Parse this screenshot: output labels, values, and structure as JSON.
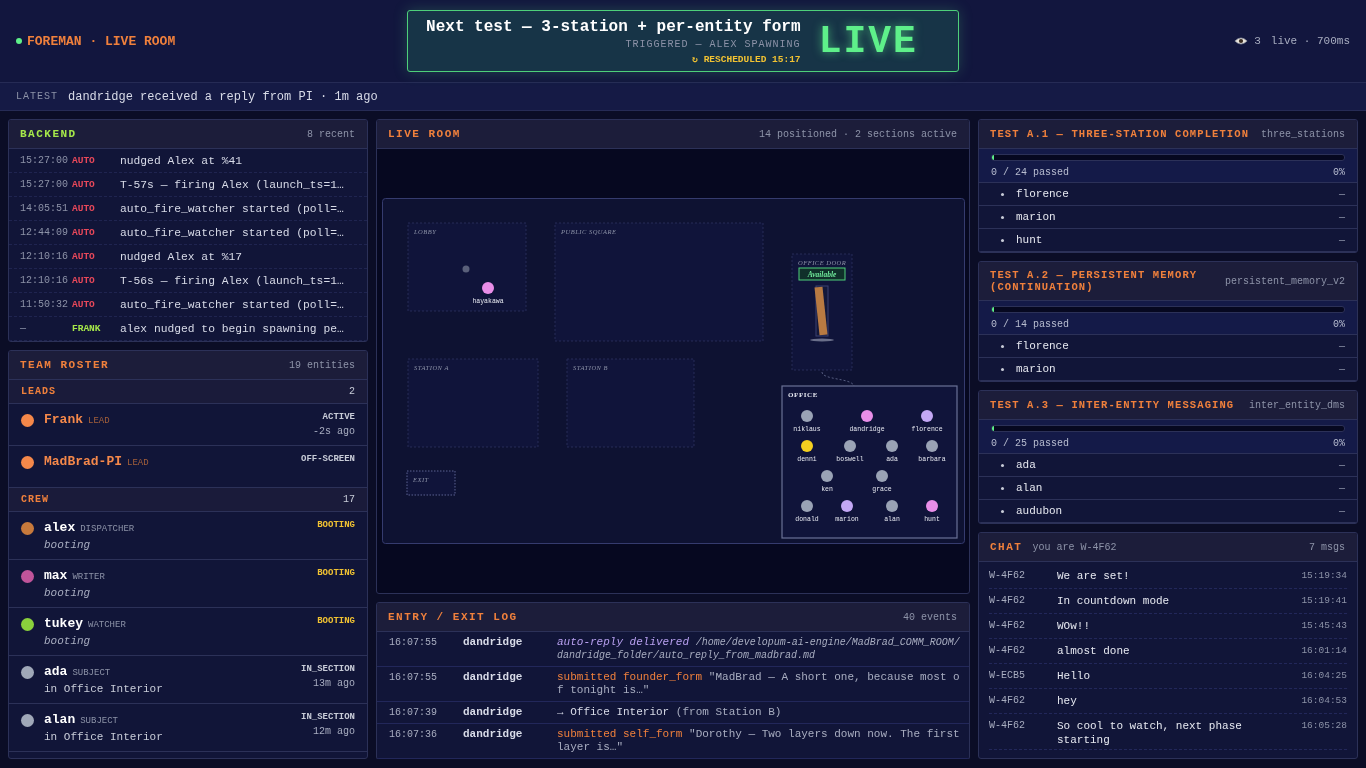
{
  "header": {
    "app_title": "FOREMAN · LIVE ROOM",
    "online": true,
    "banner": {
      "title": "Next test — 3-station + per-entity form",
      "subtitle": "TRIGGERED — ALEX SPAWNING",
      "rescheduled": "↻ RESCHEDULED 15:17",
      "status": "LIVE"
    },
    "viewers": "3",
    "mode": "live · 700ms"
  },
  "latest": {
    "label": "LATEST",
    "text": "dandridge received a reply from PI · 1m ago"
  },
  "backend": {
    "title": "BACKEND",
    "count": "8 recent",
    "rows": [
      {
        "time": "15:27:00",
        "source": "AUTO",
        "color": "#e8485a",
        "message": "nudged Alex at %41"
      },
      {
        "time": "15:27:00",
        "source": "AUTO",
        "color": "#e8485a",
        "message": "T-57s — firing Alex (launch_ts=1…"
      },
      {
        "time": "14:05:51",
        "source": "AUTO",
        "color": "#e8485a",
        "message": "auto_fire_watcher started (poll=…"
      },
      {
        "time": "12:44:09",
        "source": "AUTO",
        "color": "#e8485a",
        "message": "auto_fire_watcher started (poll=…"
      },
      {
        "time": "12:10:16",
        "source": "AUTO",
        "color": "#e8485a",
        "message": "nudged Alex at %17"
      },
      {
        "time": "12:10:16",
        "source": "AUTO",
        "color": "#e8485a",
        "message": "T-56s — firing Alex (launch_ts=1…"
      },
      {
        "time": "11:50:32",
        "source": "AUTO",
        "color": "#e8485a",
        "message": "auto_fire_watcher started (poll=…"
      },
      {
        "time": "—",
        "source": "FRANK",
        "color": "#a6e84a",
        "message": "alex nudged to begin spawning pe…"
      }
    ]
  },
  "roster": {
    "title": "TEAM ROSTER",
    "count": "19 entities",
    "groups": [
      {
        "label": "LEADS",
        "count": "2",
        "kind": "lead",
        "members": [
          {
            "name": "Frank",
            "role": "LEAD",
            "status": "ACTIVE",
            "booting": false,
            "ago": "-2s ago",
            "color": "#f5884a"
          },
          {
            "name": "MadBrad-PI",
            "role": "LEAD",
            "status": "OFF-SCREEN",
            "booting": false,
            "color": "#f5884a"
          }
        ]
      },
      {
        "label": "CREW",
        "count": "17",
        "kind": "crew",
        "members": [
          {
            "name": "alex",
            "role": "DISPATCHER",
            "status": "BOOTING",
            "booting": true,
            "sub": "booting",
            "color": "#c87a3c"
          },
          {
            "name": "max",
            "role": "WRITER",
            "status": "BOOTING",
            "booting": true,
            "sub": "booting",
            "color": "#c0549a"
          },
          {
            "name": "tukey",
            "role": "WATCHER",
            "status": "BOOTING",
            "booting": true,
            "sub": "booting",
            "color": "#8ad03c"
          },
          {
            "name": "ada",
            "role": "SUBJECT",
            "status": "IN_SECTION",
            "booting": false,
            "sub": "in Office Interior",
            "ago": "13m ago",
            "color": "#a0a8b8"
          },
          {
            "name": "alan",
            "role": "SUBJECT",
            "status": "IN_SECTION",
            "booting": false,
            "sub": "in Office Interior",
            "ago": "12m ago",
            "color": "#a0a8b8"
          }
        ]
      }
    ]
  },
  "live_room": {
    "title": "LIVE ROOM",
    "summary": "14 positioned · 2 sections active",
    "zones": [
      {
        "label": "LOBBY",
        "kind": "zone",
        "nodes": [
          {
            "kind": "marker",
            "color": "#5a607a"
          },
          {
            "kind": "entity",
            "name": "hayakawa",
            "color": "#e98ee8"
          }
        ]
      },
      {
        "label": "PUBLIC SQUARE",
        "kind": "zone"
      },
      {
        "label": "OFFICE DOOR",
        "kind": "door",
        "badge": "Available"
      },
      {
        "label": "STATION A",
        "kind": "zone"
      },
      {
        "label": "STATION B",
        "kind": "zone"
      },
      {
        "label": "EXIT",
        "kind": "exit"
      },
      {
        "label": "OFFICE",
        "kind": "room",
        "nodes": [
          {
            "kind": "entity",
            "name": "niklaus",
            "color": "#9aa3b5"
          },
          {
            "kind": "entity",
            "name": "dandridge",
            "color": "#e98ee8"
          },
          {
            "kind": "entity",
            "name": "florence",
            "color": "#c4a8f5"
          },
          {
            "kind": "entity",
            "name": "denni",
            "color": "#f5d020"
          },
          {
            "kind": "entity",
            "name": "boswell",
            "color": "#9aa3b5"
          },
          {
            "kind": "entity",
            "name": "ada",
            "color": "#9aa3b5"
          },
          {
            "kind": "entity",
            "name": "barbara",
            "color": "#9aa3b5"
          },
          {
            "kind": "entity",
            "name": "ken",
            "color": "#9aa3b5"
          },
          {
            "kind": "entity",
            "name": "grace",
            "color": "#9aa3b5"
          },
          {
            "kind": "entity",
            "name": "donald",
            "color": "#9aa3b5"
          },
          {
            "kind": "entity",
            "name": "marion",
            "color": "#c4a8f5"
          },
          {
            "kind": "entity",
            "name": "alan",
            "color": "#9aa3b5"
          },
          {
            "kind": "entity",
            "name": "hunt",
            "color": "#e98ee8"
          }
        ]
      }
    ]
  },
  "log": {
    "title": "ENTRY / EXIT LOG",
    "count": "40 events",
    "rows": [
      {
        "time": "16:07:55",
        "who": "dandridge",
        "kind": "reply",
        "action": "auto-reply delivered",
        "detail": "/home/developum-ai-engine/MadBrad_COMM_ROOM/dandridge_folder/auto_reply_from_madbrad.md"
      },
      {
        "time": "16:07:55",
        "who": "dandridge",
        "kind": "form",
        "action": "submitted founder_form",
        "detail": "\"MadBrad — A short one, because most of tonight is…\""
      },
      {
        "time": "16:07:39",
        "who": "dandridge",
        "kind": "move",
        "action": "→ Office Interior",
        "detail": "(from Station B)"
      },
      {
        "time": "16:07:36",
        "who": "dandridge",
        "kind": "form",
        "action": "submitted self_form",
        "detail": "\"Dorothy — Two layers down now. The first layer is…\""
      }
    ]
  },
  "tests": [
    {
      "title": "TEST A.1 — THREE-STATION COMPLETION",
      "code": "three_stations",
      "level": 0,
      "passed": "0 / 24 passed",
      "percent": "0%",
      "entities": [
        {
          "name": "florence",
          "result": "—"
        },
        {
          "name": "marion",
          "result": "—"
        },
        {
          "name": "hunt",
          "result": "—"
        }
      ]
    },
    {
      "title": "TEST A.2 — PERSISTENT MEMORY (CONTINUATION)",
      "code": "persistent_memory_v2",
      "level": 0,
      "passed": "0 / 14 passed",
      "percent": "0%",
      "entities": [
        {
          "name": "florence",
          "result": "—"
        },
        {
          "name": "marion",
          "result": "—"
        }
      ]
    },
    {
      "title": "TEST A.3 — INTER-ENTITY MESSAGING",
      "code": "inter_entity_dms",
      "level": 0,
      "passed": "0 / 25 passed",
      "percent": "0%",
      "entities": [
        {
          "name": "ada",
          "result": "—"
        },
        {
          "name": "alan",
          "result": "—"
        },
        {
          "name": "audubon",
          "result": "—"
        }
      ]
    }
  ],
  "chat": {
    "title": "CHAT",
    "identity": "you are W-4F62",
    "count": "7 msgs",
    "messages": [
      {
        "sender": "W-4F62",
        "text": "We are set!",
        "time": "15:19:34"
      },
      {
        "sender": "W-4F62",
        "text": "In countdown mode",
        "time": "15:19:41"
      },
      {
        "sender": "W-4F62",
        "text": "WOw!!",
        "time": "15:45:43"
      },
      {
        "sender": "W-4F62",
        "text": "almost done",
        "time": "16:01:14"
      },
      {
        "sender": "W-ECB5",
        "text": "Hello",
        "time": "16:04:25"
      },
      {
        "sender": "W-4F62",
        "text": "hey",
        "time": "16:04:53"
      },
      {
        "sender": "W-4F62",
        "text": "So cool to watch, next phase starting",
        "time": "16:05:28"
      }
    ]
  }
}
